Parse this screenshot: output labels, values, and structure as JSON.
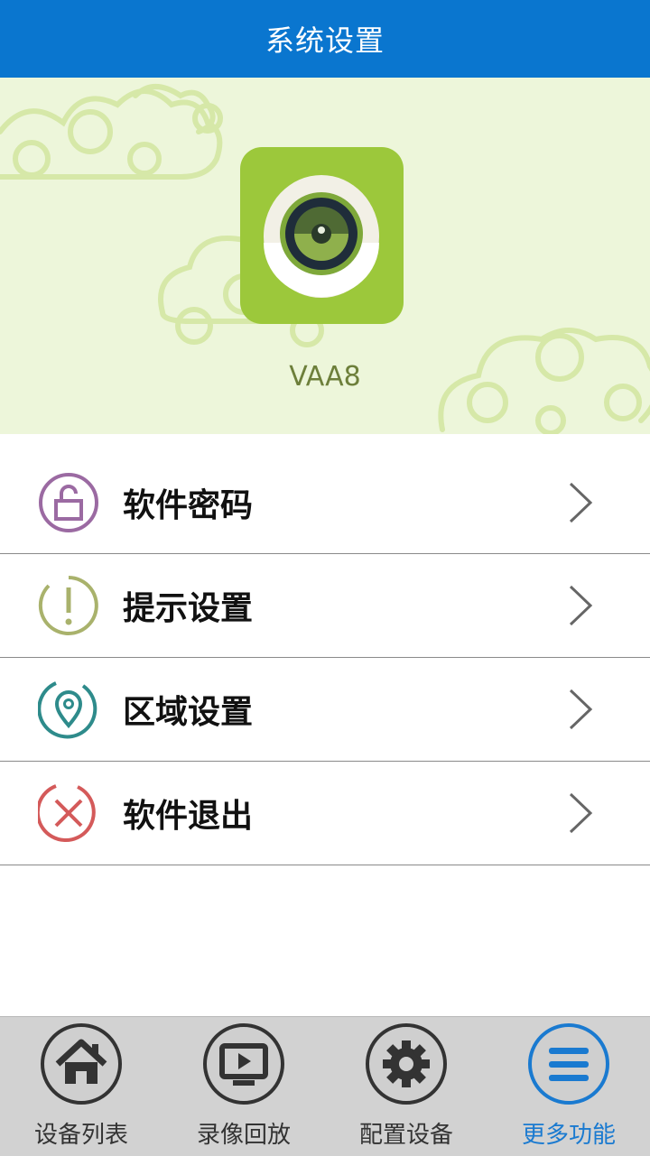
{
  "header": {
    "title": "系统设置"
  },
  "hero": {
    "app_name": "VAA8"
  },
  "menu": [
    {
      "label": "软件密码",
      "icon": "lock-icon",
      "color": "#9b6aa2"
    },
    {
      "label": "提示设置",
      "icon": "alert-icon",
      "color": "#a9b26c"
    },
    {
      "label": "区域设置",
      "icon": "location-pin-icon",
      "color": "#2e8b8b"
    },
    {
      "label": "软件退出",
      "icon": "exit-icon",
      "color": "#d45a5a"
    }
  ],
  "tabs": [
    {
      "label": "设备列表",
      "icon": "home-icon",
      "active": false
    },
    {
      "label": "录像回放",
      "icon": "playback-icon",
      "active": false
    },
    {
      "label": "配置设备",
      "icon": "gear-icon",
      "active": false
    },
    {
      "label": "更多功能",
      "icon": "menu-icon",
      "active": true
    }
  ],
  "colors": {
    "header": "#0a76cf",
    "active_tab": "#1a7ad0",
    "hero_bg": "#edf6da",
    "app_icon": "#9cc83b"
  }
}
